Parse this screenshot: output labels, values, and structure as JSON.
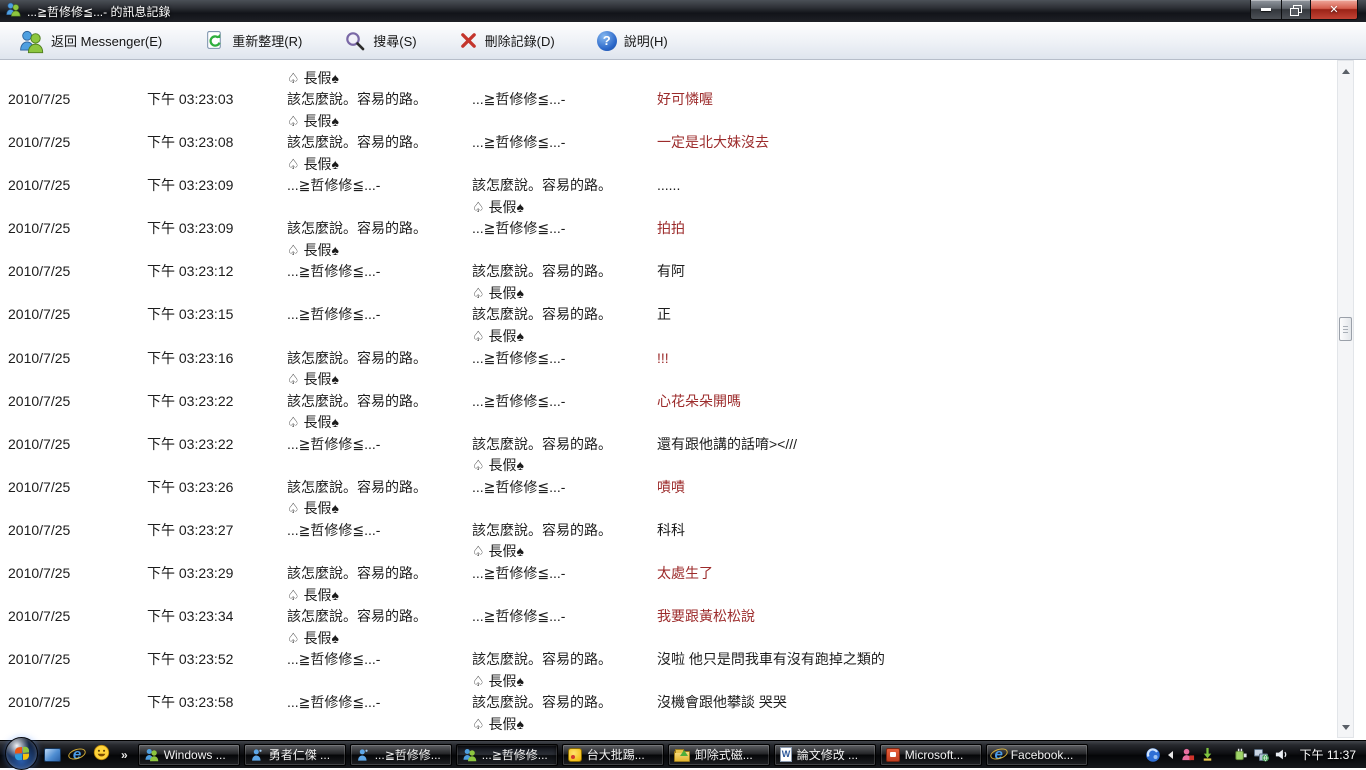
{
  "window": {
    "title": "...≧哲修修≦...- 的訊息記錄",
    "icon": "messenger-buddies-icon",
    "controls": [
      "minimize",
      "restore",
      "close"
    ]
  },
  "toolbar": {
    "back": "返回 Messenger(E)",
    "refresh": "重新整理(R)",
    "search": "搜尋(S)",
    "delete": "刪除記錄(D)",
    "help": "說明(H)"
  },
  "log": {
    "partial_top": "♤ 長假♠",
    "participants": {
      "a_line1": "該怎麼說。容易的路。",
      "a_line2": "♤ 長假♠",
      "b": "...≧哲修修≦...-"
    },
    "colors": {
      "red": "#9c2b2b",
      "black": "#1c1c1c"
    },
    "rows": [
      {
        "date": "2010/7/25",
        "time": "下午 03:23:03",
        "from1": "該怎麼說。容易的路。",
        "from2": "♤ 長假♠",
        "to1": "...≧哲修修≦...-",
        "to2": "",
        "msg": "好可憐喔",
        "msg_color": "#9c2b2b"
      },
      {
        "date": "2010/7/25",
        "time": "下午 03:23:08",
        "from1": "該怎麼說。容易的路。",
        "from2": "♤ 長假♠",
        "to1": "...≧哲修修≦...-",
        "to2": "",
        "msg": "一定是北大妹沒去",
        "msg_color": "#9c2b2b"
      },
      {
        "date": "2010/7/25",
        "time": "下午 03:23:09",
        "from1": "...≧哲修修≦...-",
        "from2": "",
        "to1": "該怎麼說。容易的路。",
        "to2": "♤ 長假♠",
        "msg": "......",
        "msg_color": "#1c1c1c"
      },
      {
        "date": "2010/7/25",
        "time": "下午 03:23:09",
        "from1": "該怎麼說。容易的路。",
        "from2": "♤ 長假♠",
        "to1": "...≧哲修修≦...-",
        "to2": "",
        "msg": "拍拍",
        "msg_color": "#9c2b2b"
      },
      {
        "date": "2010/7/25",
        "time": "下午 03:23:12",
        "from1": "...≧哲修修≦...-",
        "from2": "",
        "to1": "該怎麼說。容易的路。",
        "to2": "♤ 長假♠",
        "msg": "有阿",
        "msg_color": "#1c1c1c"
      },
      {
        "date": "2010/7/25",
        "time": "下午 03:23:15",
        "from1": "...≧哲修修≦...-",
        "from2": "",
        "to1": "該怎麼說。容易的路。",
        "to2": "♤ 長假♠",
        "msg": "正",
        "msg_color": "#1c1c1c"
      },
      {
        "date": "2010/7/25",
        "time": "下午 03:23:16",
        "from1": "該怎麼說。容易的路。",
        "from2": "♤ 長假♠",
        "to1": "...≧哲修修≦...-",
        "to2": "",
        "msg": "!!!",
        "msg_color": "#9c2b2b"
      },
      {
        "date": "2010/7/25",
        "time": "下午 03:23:22",
        "from1": "該怎麼說。容易的路。",
        "from2": "♤ 長假♠",
        "to1": "...≧哲修修≦...-",
        "to2": "",
        "msg": "心花朵朵開嗎",
        "msg_color": "#9c2b2b"
      },
      {
        "date": "2010/7/25",
        "time": "下午 03:23:22",
        "from1": "...≧哲修修≦...-",
        "from2": "",
        "to1": "該怎麼說。容易的路。",
        "to2": "♤ 長假♠",
        "msg": "還有跟他講的話唷></// ",
        "msg_color": "#1c1c1c"
      },
      {
        "date": "2010/7/25",
        "time": "下午 03:23:26",
        "from1": "該怎麼說。容易的路。",
        "from2": "♤ 長假♠",
        "to1": "...≧哲修修≦...-",
        "to2": "",
        "msg": "嘖嘖",
        "msg_color": "#9c2b2b"
      },
      {
        "date": "2010/7/25",
        "time": "下午 03:23:27",
        "from1": "...≧哲修修≦...-",
        "from2": "",
        "to1": "該怎麼說。容易的路。",
        "to2": "♤ 長假♠",
        "msg": "科科",
        "msg_color": "#1c1c1c"
      },
      {
        "date": "2010/7/25",
        "time": "下午 03:23:29",
        "from1": "該怎麼說。容易的路。",
        "from2": "♤ 長假♠",
        "to1": "...≧哲修修≦...-",
        "to2": "",
        "msg": "太處生了",
        "msg_color": "#9c2b2b"
      },
      {
        "date": "2010/7/25",
        "time": "下午 03:23:34",
        "from1": "該怎麼說。容易的路。",
        "from2": "♤ 長假♠",
        "to1": "...≧哲修修≦...-",
        "to2": "",
        "msg": "我要跟黃松松說",
        "msg_color": "#9c2b2b"
      },
      {
        "date": "2010/7/25",
        "time": "下午 03:23:52",
        "from1": "...≧哲修修≦...-",
        "from2": "",
        "to1": "該怎麼說。容易的路。",
        "to2": "♤ 長假♠",
        "msg": "沒啦 他只是問我車有沒有跑掉之類的",
        "msg_color": "#1c1c1c"
      },
      {
        "date": "2010/7/25",
        "time": "下午 03:23:58",
        "from1": "...≧哲修修≦...-",
        "from2": "",
        "to1": "該怎麼說。容易的路。",
        "to2": "♤ 長假♠",
        "msg": "沒機會跟他攀談 哭哭",
        "msg_color": "#1c1c1c"
      }
    ]
  },
  "taskbar": {
    "overflow_chevron": "»",
    "quick_launch": [
      "show-desktop-icon",
      "internet-explorer-icon",
      "smiley-icon"
    ],
    "buttons": [
      {
        "label": "Windows ...",
        "icon": "messenger-buddies",
        "active": false
      },
      {
        "label": "勇者仁傑 ...",
        "icon": "messenger-buddy",
        "active": false
      },
      {
        "label": "...≧哲修修...",
        "icon": "messenger-buddy",
        "active": false
      },
      {
        "label": "...≧哲修修...",
        "icon": "messenger-buddies",
        "active": true
      },
      {
        "label": "台大批踢...",
        "icon": "ptt",
        "active": false
      },
      {
        "label": "卸除式磁...",
        "icon": "folder-removable",
        "active": false
      },
      {
        "label": "論文修改 ...",
        "icon": "word-document",
        "active": false
      },
      {
        "label": "Microsoft...",
        "icon": "powerpoint",
        "active": false
      },
      {
        "label": "Facebook...",
        "icon": "internet-explorer",
        "active": false
      }
    ],
    "tray_icons": [
      "blue-swirl",
      "hide-icons-chevron",
      "messenger-status",
      "safely-remove-hardware",
      "power-plug",
      "network",
      "volume"
    ],
    "clock": "下午 11:37"
  }
}
